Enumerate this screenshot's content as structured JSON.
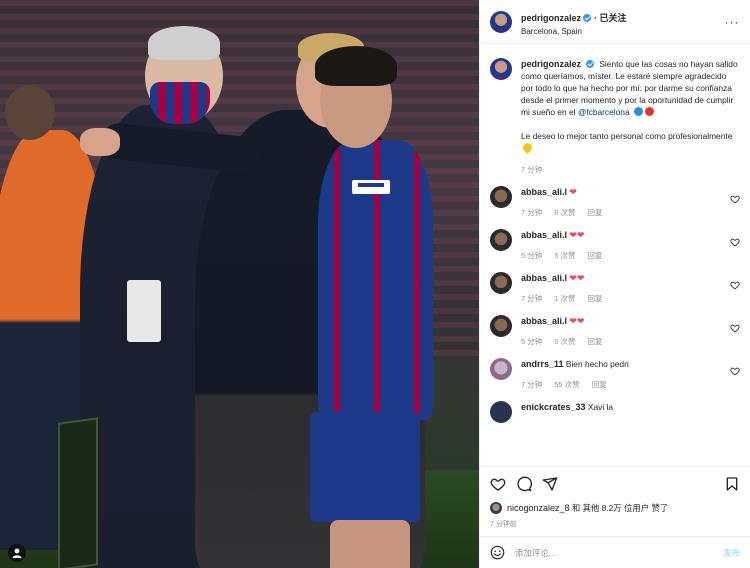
{
  "post": {
    "author": "pedrigonzalez",
    "follow_label": "· 已关注",
    "location": "Barcelona, Spain",
    "more_label": "···"
  },
  "caption": {
    "author": "pedrigonzalez",
    "text": "Siento que las cosas no hayan salido como queríamos, míster. Le estaré siempre agradecido por todo lo que ha hecho por mí: por darme su confianza desde el primer momento y por la oportunidad de cumplir mi sueño en el",
    "mention": "@fcbarcelona",
    "text2": "Le deseo lo mejor tanto personal como profesionalmente",
    "time": "7 分钟"
  },
  "comments": [
    {
      "user": "abbas_ali.l",
      "hearts": "❤",
      "time": "7 分钟",
      "likes": "6 次赞",
      "reply": "回复"
    },
    {
      "user": "abbas_ali.l",
      "hearts": "❤❤",
      "time": "5 分钟",
      "likes": "5 次赞",
      "reply": "回复"
    },
    {
      "user": "abbas_ali.l",
      "hearts": "❤❤",
      "time": "7 分钟",
      "likes": "1 次赞",
      "reply": "回复"
    },
    {
      "user": "abbas_ali.l",
      "hearts": "❤❤",
      "time": "5 分钟",
      "likes": "5 次赞",
      "reply": "回复"
    },
    {
      "user": "andrrs_11",
      "text": "Bien hecho pedri",
      "time": "7 分钟",
      "likes": "55 次赞",
      "reply": "回复"
    },
    {
      "user": "enickcrates_33",
      "text": "Xavi la"
    }
  ],
  "likes": {
    "user": "nicogonzalez_8",
    "rest": "和 其他 8.2万 位用户 赞了"
  },
  "ago": "7 分钟前",
  "add_comment": {
    "placeholder": "添加评论...",
    "post_label": "发布"
  },
  "colors": {
    "accent": "#3897f0",
    "heart": "#ed4956",
    "barca_blue": "#1d3a8a",
    "barca_red": "#a50044"
  }
}
